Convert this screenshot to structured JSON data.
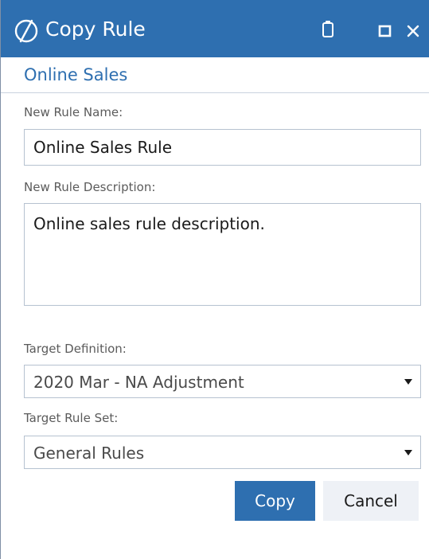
{
  "window": {
    "title": "Copy Rule",
    "logo_icon": "rule-logo-icon",
    "titlebar_color": "#2e6fb0",
    "controls": {
      "clipboard_icon": "clipboard-icon",
      "maximize_icon": "maximize-icon",
      "close_icon": "close-icon"
    }
  },
  "record": {
    "title": "Online Sales"
  },
  "form": {
    "name_label": "New Rule Name:",
    "name_value": "Online Sales Rule",
    "description_label": "New Rule Description:",
    "description_value": "Online sales rule description.",
    "target_definition_label": "Target Definition:",
    "target_definition_value": "2020 Mar - NA Adjustment",
    "target_rule_set_label": "Target Rule Set:",
    "target_rule_set_value": "General Rules"
  },
  "actions": {
    "copy_label": "Copy",
    "cancel_label": "Cancel",
    "primary_color": "#2e6fb0"
  }
}
